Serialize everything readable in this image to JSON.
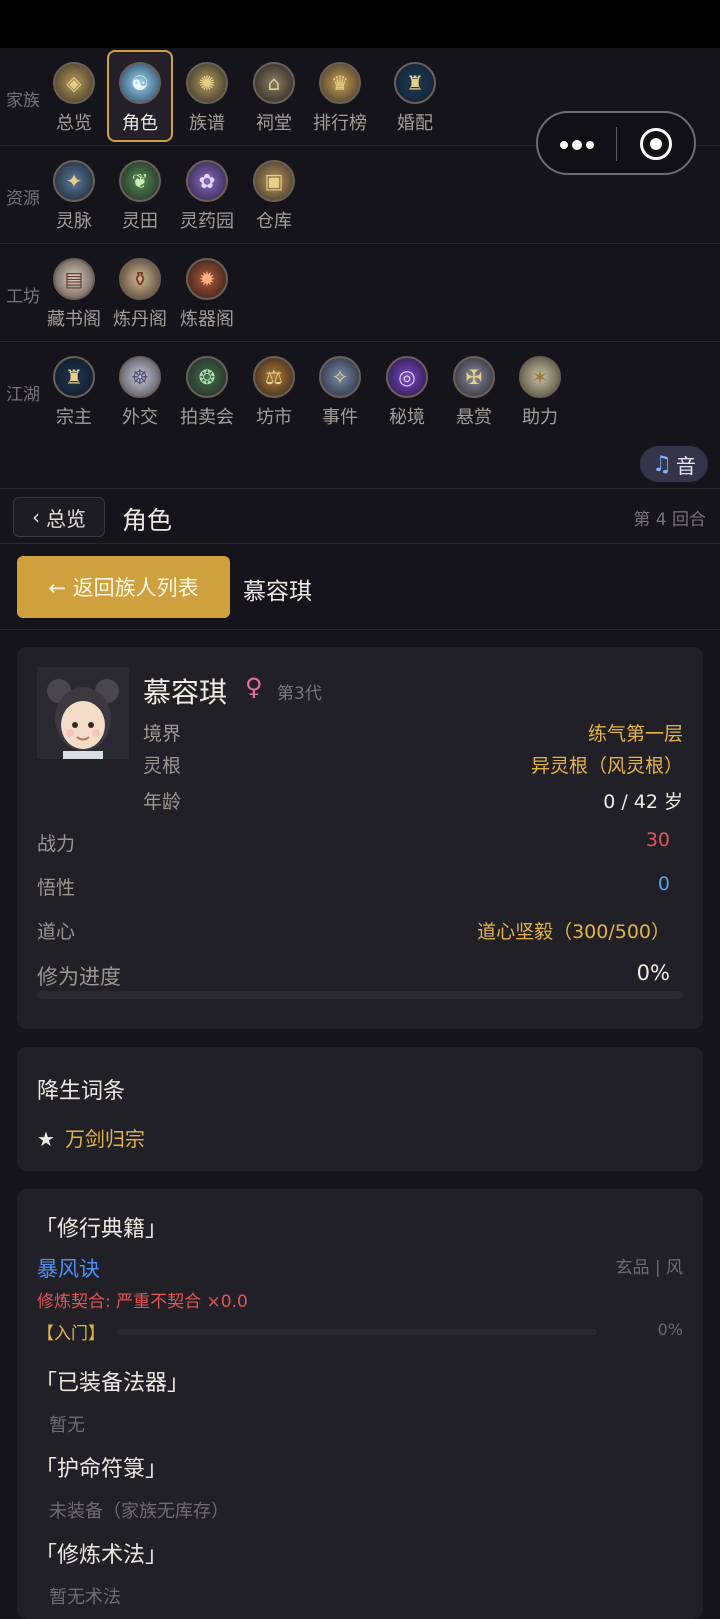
{
  "menu": {
    "rows": [
      {
        "label": "家族",
        "items": [
          {
            "label": "总览",
            "icon": "clan-overview-icon",
            "active": false
          },
          {
            "label": "角色",
            "icon": "character-icon",
            "active": true
          },
          {
            "label": "族谱",
            "icon": "family-tree-icon",
            "active": false
          },
          {
            "label": "祠堂",
            "icon": "ancestral-hall-icon",
            "active": false
          },
          {
            "label": "排行榜",
            "icon": "leaderboard-icon",
            "active": false
          },
          {
            "label": "婚配",
            "icon": "marriage-icon",
            "active": false
          }
        ]
      },
      {
        "label": "资源",
        "items": [
          {
            "label": "灵脉",
            "icon": "spirit-vein-icon"
          },
          {
            "label": "灵田",
            "icon": "spirit-field-icon"
          },
          {
            "label": "灵药园",
            "icon": "herb-garden-icon"
          },
          {
            "label": "仓库",
            "icon": "warehouse-icon"
          }
        ]
      },
      {
        "label": "工坊",
        "items": [
          {
            "label": "藏书阁",
            "icon": "library-icon"
          },
          {
            "label": "炼丹阁",
            "icon": "alchemy-icon"
          },
          {
            "label": "炼器阁",
            "icon": "forge-icon"
          }
        ]
      },
      {
        "label": "江湖",
        "items": [
          {
            "label": "宗主",
            "icon": "sect-master-icon"
          },
          {
            "label": "外交",
            "icon": "diplomacy-icon"
          },
          {
            "label": "拍卖会",
            "icon": "auction-icon"
          },
          {
            "label": "坊市",
            "icon": "market-icon"
          },
          {
            "label": "事件",
            "icon": "event-icon"
          },
          {
            "label": "秘境",
            "icon": "secret-realm-icon"
          },
          {
            "label": "悬赏",
            "icon": "bounty-icon"
          },
          {
            "label": "助力",
            "icon": "boost-icon"
          }
        ]
      }
    ]
  },
  "music_button": {
    "label": "音",
    "icon": "music-note-icon"
  },
  "nav": {
    "back_label": "总览",
    "title": "角色",
    "round": "第 4 回合"
  },
  "sub": {
    "back_label": "← 返回族人列表",
    "name": "慕容琪"
  },
  "character": {
    "name": "慕容琪",
    "gender_symbol": "♀",
    "generation": "第3代",
    "realm_label": "境界",
    "realm": "练气第一层",
    "root_label": "灵根",
    "root": "异灵根（风灵根）",
    "age_label": "年龄",
    "age": "0 / 42 岁",
    "power_label": "战力",
    "power": "30",
    "insight_label": "悟性",
    "insight": "0",
    "heart_label": "道心",
    "heart": "道心坚毅（300/500）",
    "progress_label": "修为进度",
    "progress": "0%",
    "progress_fraction": 0
  },
  "birth_traits": {
    "title": "降生词条",
    "star": "★",
    "trait": "万剑归宗"
  },
  "equipment": {
    "books_title": "「修行典籍」",
    "book_name": "暴风诀",
    "book_grade": "玄品 | 风",
    "book_fit": "修炼契合: 严重不契合 ×0.0",
    "book_level": "【入门】",
    "book_progress": "0%",
    "artifact_title": "「已装备法器」",
    "artifact_value": "暂无",
    "talisman_title": "「护命符箓」",
    "talisman_value": "未装备（家族无库存）",
    "skill_title": "「修炼术法」",
    "skill_value": "暂无术法"
  },
  "colors": {
    "accent": "#cfa13e",
    "background": "#16141b",
    "card": "#222027",
    "gold_text": "#e3b445",
    "red_text": "#e05555",
    "blue_text": "#5c9ee8"
  }
}
